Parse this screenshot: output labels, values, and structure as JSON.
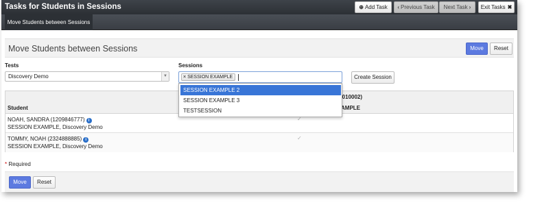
{
  "titlebar": {
    "title": "Tasks for Students in Sessions",
    "add_task": "Add Task",
    "previous_task": "Previous Task",
    "next_task": "Next Task",
    "exit_tasks": "Exit Tasks"
  },
  "tabs": [
    {
      "label": "Move Students between Sessions",
      "active": true
    }
  ],
  "panel": {
    "title": "Move Students between Sessions",
    "move_label": "Move",
    "reset_label": "Reset"
  },
  "tests": {
    "label": "Tests",
    "selected": "Discovery Demo"
  },
  "sessions": {
    "label": "Sessions",
    "selected_chip": "SESSION EXAMPLE",
    "options": [
      "SESSION EXAMPLE 2",
      "SESSION EXAMPLE 3",
      "TESTSESSION"
    ],
    "highlighted_index": 0
  },
  "create_session_label": "Create Session",
  "table": {
    "header_student": "Student",
    "header_session_code": "(010002)",
    "header_session_name": "AMPLE",
    "rows": [
      {
        "name": "NOAH, SANDRA (1209846777)",
        "detail": "SESSION EXAMPLE, Discovery Demo",
        "checked": true
      },
      {
        "name": "TOMMY, NOAH (2324888885)",
        "detail": "SESSION EXAMPLE, Discovery Demo",
        "checked": true
      }
    ]
  },
  "required_text": "Required",
  "footer": {
    "move_label": "Move",
    "reset_label": "Reset"
  },
  "colors": {
    "primary_button": "#5c7ae0",
    "dropdown_highlight": "#3875d7",
    "titlebar": "#2c3035",
    "info_icon": "#2a6fc9"
  }
}
